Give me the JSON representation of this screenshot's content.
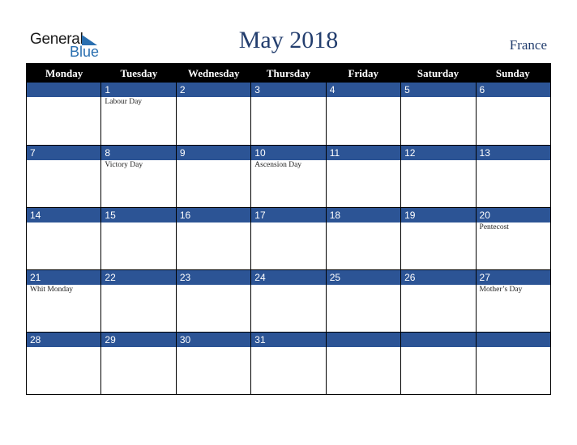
{
  "logo": {
    "line1": "General",
    "line2": "Blue",
    "icon": "triangle-flag-icon"
  },
  "header": {
    "title": "May 2018",
    "country": "France"
  },
  "colors": {
    "band": "#2c5495",
    "title": "#233e6e",
    "header_bg": "#000000"
  },
  "weekdays": [
    "Monday",
    "Tuesday",
    "Wednesday",
    "Thursday",
    "Friday",
    "Saturday",
    "Sunday"
  ],
  "weeks": [
    [
      {
        "day": "",
        "holiday": ""
      },
      {
        "day": "1",
        "holiday": "Labour Day"
      },
      {
        "day": "2",
        "holiday": ""
      },
      {
        "day": "3",
        "holiday": ""
      },
      {
        "day": "4",
        "holiday": ""
      },
      {
        "day": "5",
        "holiday": ""
      },
      {
        "day": "6",
        "holiday": ""
      }
    ],
    [
      {
        "day": "7",
        "holiday": ""
      },
      {
        "day": "8",
        "holiday": "Victory Day"
      },
      {
        "day": "9",
        "holiday": ""
      },
      {
        "day": "10",
        "holiday": "Ascension Day"
      },
      {
        "day": "11",
        "holiday": ""
      },
      {
        "day": "12",
        "holiday": ""
      },
      {
        "day": "13",
        "holiday": ""
      }
    ],
    [
      {
        "day": "14",
        "holiday": ""
      },
      {
        "day": "15",
        "holiday": ""
      },
      {
        "day": "16",
        "holiday": ""
      },
      {
        "day": "17",
        "holiday": ""
      },
      {
        "day": "18",
        "holiday": ""
      },
      {
        "day": "19",
        "holiday": ""
      },
      {
        "day": "20",
        "holiday": "Pentecost"
      }
    ],
    [
      {
        "day": "21",
        "holiday": "Whit Monday"
      },
      {
        "day": "22",
        "holiday": ""
      },
      {
        "day": "23",
        "holiday": ""
      },
      {
        "day": "24",
        "holiday": ""
      },
      {
        "day": "25",
        "holiday": ""
      },
      {
        "day": "26",
        "holiday": ""
      },
      {
        "day": "27",
        "holiday": "Mother’s Day"
      }
    ],
    [
      {
        "day": "28",
        "holiday": ""
      },
      {
        "day": "29",
        "holiday": ""
      },
      {
        "day": "30",
        "holiday": ""
      },
      {
        "day": "31",
        "holiday": ""
      },
      {
        "day": "",
        "holiday": ""
      },
      {
        "day": "",
        "holiday": ""
      },
      {
        "day": "",
        "holiday": ""
      }
    ]
  ]
}
